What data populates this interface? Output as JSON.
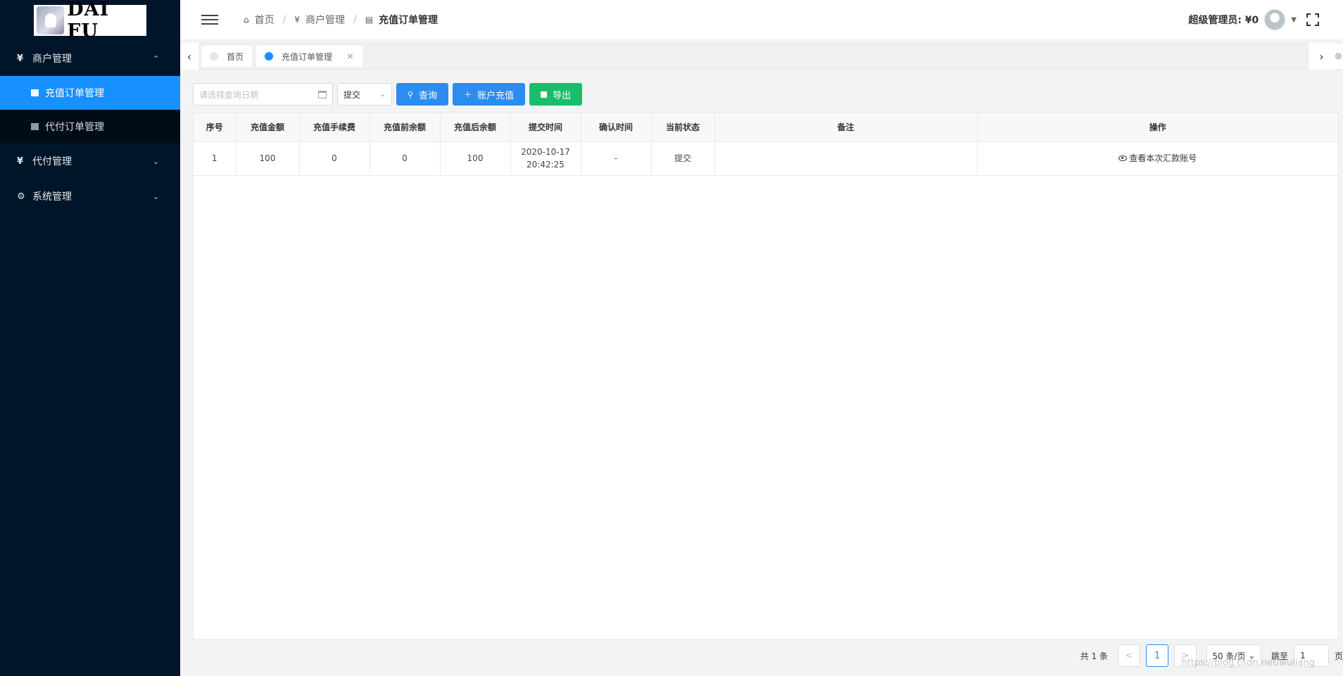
{
  "logo": {
    "text": "DAI FU"
  },
  "sidebar": {
    "groups": [
      {
        "icon": "¥",
        "label": "商户管理",
        "caret": "⌃",
        "items": [
          {
            "label": "充值订单管理",
            "active": true
          },
          {
            "label": "代付订单管理",
            "active": false
          }
        ]
      },
      {
        "icon": "¥",
        "label": "代付管理",
        "caret": "⌄"
      },
      {
        "icon": "⚙",
        "label": "系统管理",
        "caret": "⌄"
      }
    ]
  },
  "header": {
    "breadcrumb": [
      {
        "icon": "home-icon",
        "label": "首页"
      },
      {
        "icon": "yen-icon",
        "label": "商户管理"
      },
      {
        "icon": "list-icon",
        "label": "充值订单管理"
      }
    ],
    "admin_label": "超级管理员: ¥0"
  },
  "tabs": [
    {
      "label": "首页",
      "active": false
    },
    {
      "label": "充值订单管理",
      "active": true,
      "close": "×"
    }
  ],
  "toolbar": {
    "date_placeholder": "请选择查询日期",
    "status_select": "提交",
    "query_label": "查询",
    "recharge_label": "账户充值",
    "export_label": "导出"
  },
  "table": {
    "columns": [
      "序号",
      "充值金额",
      "充值手续费",
      "充值前余额",
      "充值后余额",
      "提交时间",
      "确认时间",
      "当前状态",
      "备注",
      "操作"
    ],
    "rows": [
      {
        "index": "1",
        "amount": "100",
        "fee": "0",
        "before": "0",
        "after": "100",
        "submit_date": "2020-10-17",
        "submit_time": "20:42:25",
        "confirm_time": "-",
        "status": "提交",
        "remark": "",
        "action": "查看本次汇款账号"
      }
    ]
  },
  "pagination": {
    "total": "共 1 条",
    "prev": "<",
    "current": "1",
    "next": ">",
    "page_size": "50 条/页",
    "jump_label": "跳至",
    "jump_value": "1",
    "page_suffix": "页"
  },
  "watermark": "https://blog.csdn.net/wuliang"
}
